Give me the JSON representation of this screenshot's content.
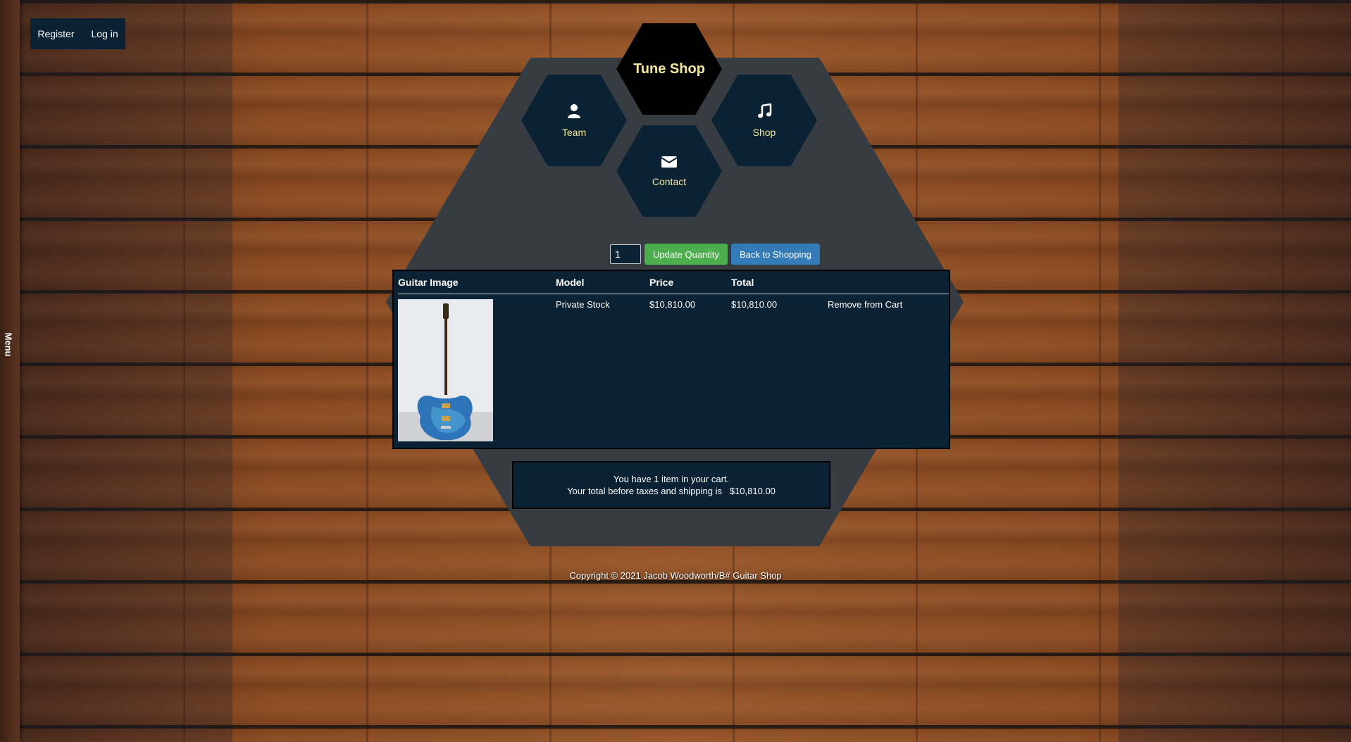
{
  "side_menu": {
    "label": "Menu"
  },
  "auth": {
    "register": "Register",
    "login": "Log in"
  },
  "brand": {
    "title": "Tune Shop"
  },
  "nav": [
    {
      "label": "Team",
      "icon": "user-icon"
    },
    {
      "label": "Shop",
      "icon": "music-icon"
    },
    {
      "label": "Contact",
      "icon": "envelope-icon"
    }
  ],
  "controls": {
    "quantity": "1",
    "update_label": "Update Quantity",
    "back_label": "Back to Shopping"
  },
  "cart": {
    "headers": [
      "Guitar Image",
      "Model",
      "Price",
      "Total",
      ""
    ],
    "rows": [
      {
        "image": "guitar-image",
        "model": "Private Stock",
        "price": "$10,810.00",
        "total": "$10,810.00",
        "action": "Remove from Cart"
      }
    ]
  },
  "summary": {
    "line1": "You have 1 item in your cart.",
    "line2": "Your total before taxes and shipping is   $10,810.00"
  },
  "footer": {
    "text": "Copyright © 2021 Jacob Woodworth/B# Guitar Shop"
  },
  "colors": {
    "panel": "#0b2234",
    "accent_text": "#f5e79a",
    "green_button": "#4cae4c",
    "blue_button": "#337ab7",
    "hex_bg": "#363c42"
  }
}
